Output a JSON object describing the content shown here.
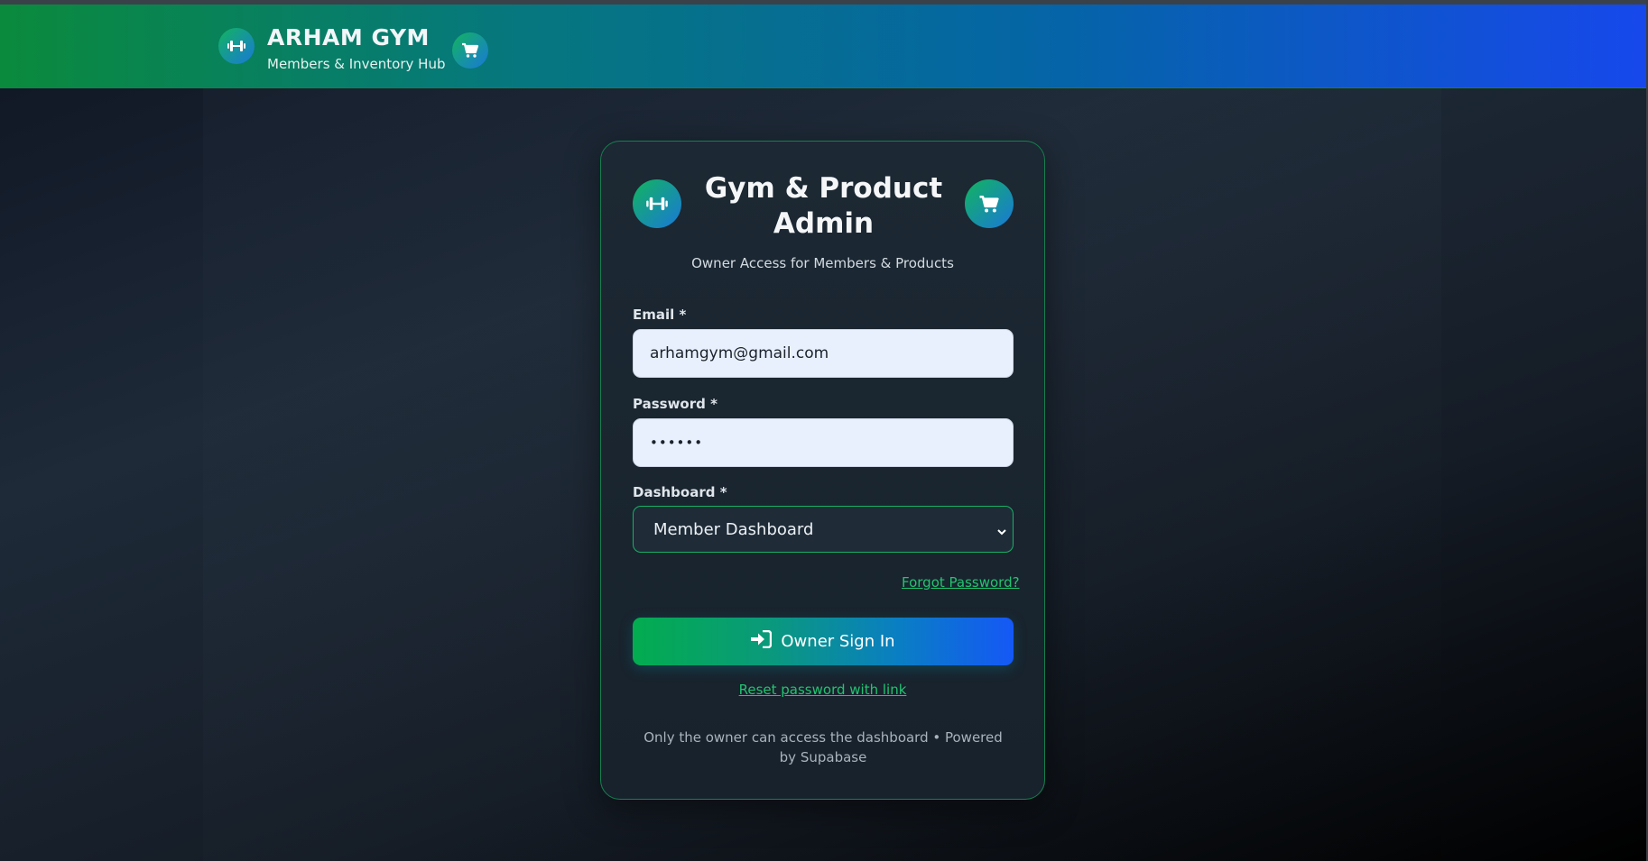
{
  "header": {
    "title": "ARHAM GYM",
    "subtitle": "Members & Inventory Hub",
    "logo_icon": "dumbbell-icon",
    "cart_icon": "cart-icon"
  },
  "login": {
    "title": "Gym & Product Admin",
    "subtitle": "Owner Access for Members & Products",
    "email_label": "Email *",
    "email_value": "arhamgym@gmail.com",
    "password_label": "Password *",
    "password_value": "••••••",
    "dashboard_label": "Dashboard *",
    "dashboard_selected": "Member Dashboard",
    "forgot_link": "Forgot Password?",
    "signin_label": "Owner Sign In",
    "reset_link": "Reset password with link",
    "footer": "Only the owner can access the dashboard • Powered by Supabase"
  },
  "colors": {
    "accent_green": "#22c470",
    "brand_blue": "#1558f6",
    "card_border": "#16804e"
  }
}
